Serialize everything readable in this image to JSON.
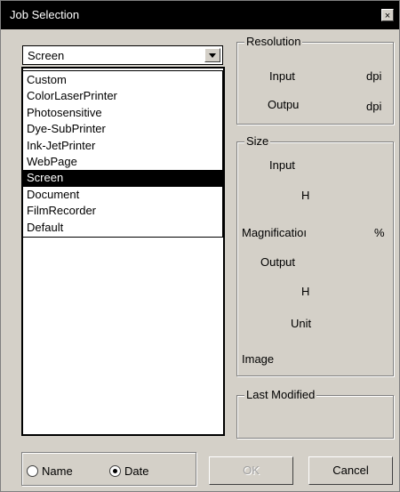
{
  "window": {
    "title": "Job Selection",
    "close_glyph": "×"
  },
  "job_combo": {
    "value": "Screen"
  },
  "dropdown": {
    "items": [
      "Custom",
      "ColorLaserPrinter",
      "Photosensitive",
      "Dye-SubPrinter",
      "Ink-JetPrinter",
      "WebPage",
      "Screen",
      "Document",
      "FilmRecorder",
      "Default"
    ],
    "selected": "Screen"
  },
  "resolution": {
    "title": "Resolution",
    "input_label": "Input",
    "output_label": "Outpu",
    "unit": "dpi"
  },
  "size": {
    "title": "Size",
    "input_label": "Input",
    "h_label": "H",
    "magnification_label": "Magnificatioı",
    "percent": "%",
    "output_label": "Output",
    "h2_label": "H",
    "unit_label": "Unit",
    "image_label": "Image"
  },
  "last_modified": {
    "title": "Last Modified"
  },
  "sort": {
    "name_label": "Name",
    "date_label": "Date",
    "selected": "date"
  },
  "buttons": {
    "ok": "OK",
    "cancel": "Cancel"
  }
}
